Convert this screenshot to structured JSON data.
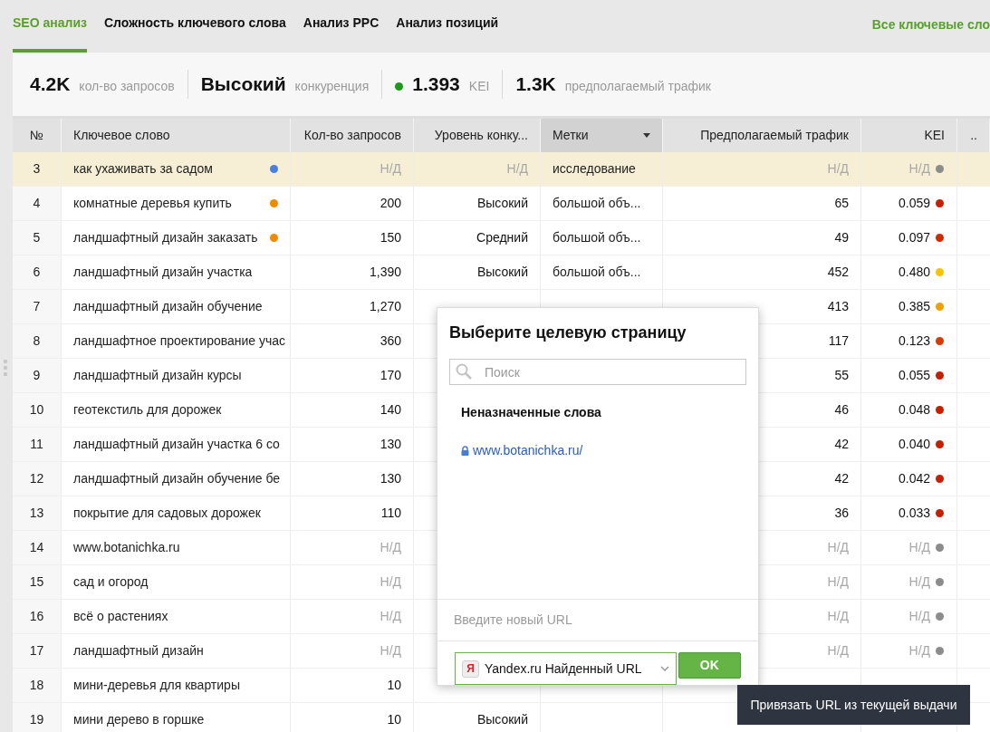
{
  "tabs": [
    {
      "label": "SEO анализ",
      "selected": true
    },
    {
      "label": "Сложность ключевого слова",
      "selected": false
    },
    {
      "label": "Анализ PPC",
      "selected": false
    },
    {
      "label": "Анализ позиций",
      "selected": false
    }
  ],
  "top_link": "Все ключевые сло",
  "summary": [
    {
      "value": "4.2K",
      "label": "кол-во запросов"
    },
    {
      "value": "Высокий",
      "label": "конкуренция"
    },
    {
      "value": "1.393",
      "label": "KEI",
      "color": "#1a9a1a"
    },
    {
      "value": "1.3K",
      "label": "предполагаемый трафик"
    }
  ],
  "table": {
    "columns": [
      {
        "label": "№",
        "sorted": false
      },
      {
        "label": "Ключевое слово",
        "sorted": false
      },
      {
        "label": "Кол-во запросов",
        "sorted": false
      },
      {
        "label": "Уровень конку...",
        "sorted": false
      },
      {
        "label": "Метки",
        "sorted": true
      },
      {
        "label": "Предполагаемый трафик",
        "sorted": false
      },
      {
        "label": "KEI",
        "sorted": false
      },
      {
        "label": "..",
        "sorted": false
      }
    ],
    "rows": [
      {
        "num": "3",
        "keyword": "как ухаживать за садом",
        "color": "#4a7fe0",
        "count": "Н/Д",
        "competition": "Н/Д",
        "tags": "исследование",
        "traffic": "Н/Д",
        "kei": {
          "value": "Н/Д",
          "color": "#8c8c8c"
        },
        "na": true,
        "selected": true
      },
      {
        "num": "4",
        "keyword": "комнатные деревья купить",
        "color": "#f08a00",
        "count": "200",
        "competition": "Высокий",
        "tags": "большой объ...",
        "traffic": "65",
        "kei": {
          "value": "0.059",
          "color": "#c81e00"
        },
        "na": false,
        "selected": false
      },
      {
        "num": "5",
        "keyword": "ландшафтный дизайн заказать",
        "color": "#f08a00",
        "count": "150",
        "competition": "Средний",
        "tags": "большой объ...",
        "traffic": "49",
        "kei": {
          "value": "0.097",
          "color": "#d02a00"
        },
        "na": false,
        "selected": false
      },
      {
        "num": "6",
        "keyword": "ландшафтный дизайн участка",
        "count": "1,390",
        "competition": "Высокий",
        "tags": "большой объ...",
        "traffic": "452",
        "kei": {
          "value": "0.480",
          "color": "#f8c400"
        },
        "na": false,
        "selected": false
      },
      {
        "num": "7",
        "keyword": "ландшафтный дизайн обучение",
        "count": "1,270",
        "traffic": "413",
        "kei": {
          "value": "0.385",
          "color": "#f0a000"
        },
        "na": false,
        "selected": false
      },
      {
        "num": "8",
        "keyword": "ландшафтное проектирование учас",
        "count": "360",
        "traffic": "117",
        "kei": {
          "value": "0.123",
          "color": "#d83a00"
        },
        "na": false,
        "selected": false
      },
      {
        "num": "9",
        "keyword": "ландшафтный дизайн курсы",
        "count": "170",
        "traffic": "55",
        "kei": {
          "value": "0.055",
          "color": "#c81e00"
        },
        "na": false,
        "selected": false
      },
      {
        "num": "10",
        "keyword": "геотекстиль для дорожек",
        "count": "140",
        "traffic": "46",
        "kei": {
          "value": "0.048",
          "color": "#c81e00"
        },
        "na": false,
        "selected": false
      },
      {
        "num": "11",
        "keyword": "ландшафтный дизайн участка 6 со",
        "count": "130",
        "traffic": "42",
        "kei": {
          "value": "0.040",
          "color": "#c81e00"
        },
        "na": false,
        "selected": false
      },
      {
        "num": "12",
        "keyword": "ландшафтный дизайн обучение бе",
        "count": "130",
        "traffic": "42",
        "kei": {
          "value": "0.042",
          "color": "#c81e00"
        },
        "na": false,
        "selected": false
      },
      {
        "num": "13",
        "keyword": "покрытие для садовых дорожек",
        "count": "110",
        "traffic": "36",
        "kei": {
          "value": "0.033",
          "color": "#c81e00"
        },
        "na": false,
        "selected": false
      },
      {
        "num": "14",
        "keyword": "www.botanichka.ru",
        "count": "Н/Д",
        "traffic": "Н/Д",
        "kei": {
          "value": "Н/Д",
          "color": "#8c8c8c"
        },
        "na": true,
        "selected": false
      },
      {
        "num": "15",
        "keyword": "сад и огород",
        "count": "Н/Д",
        "traffic": "Н/Д",
        "kei": {
          "value": "Н/Д",
          "color": "#8c8c8c"
        },
        "na": true,
        "selected": false
      },
      {
        "num": "16",
        "keyword": "всё о растениях",
        "count": "Н/Д",
        "traffic": "Н/Д",
        "kei": {
          "value": "Н/Д",
          "color": "#8c8c8c"
        },
        "na": true,
        "selected": false
      },
      {
        "num": "17",
        "keyword": "ландшафтный дизайн",
        "count": "Н/Д",
        "traffic": "Н/Д",
        "kei": {
          "value": "Н/Д",
          "color": "#8c8c8c"
        },
        "na": true,
        "selected": false
      },
      {
        "num": "18",
        "keyword": "мини-деревья для квартиры",
        "count": "10",
        "na": false,
        "selected": false
      },
      {
        "num": "19",
        "keyword": "мини дерево в горшке",
        "count": "10",
        "competition": "Высокий",
        "na": false,
        "selected": false
      }
    ]
  },
  "dialog": {
    "title": "Выберите целевую страницу",
    "search": {
      "placeholder": "Поиск"
    },
    "section": "Неназначенные слова",
    "link": "www.botanichka.ru/",
    "new_url": {
      "placeholder": "Введите новый URL"
    },
    "source": {
      "icon_letter": "Я",
      "value": "Yandex.ru Найденный URL"
    },
    "ok": "OK"
  },
  "tooltip": "Привязать URL из текущей выдачи"
}
